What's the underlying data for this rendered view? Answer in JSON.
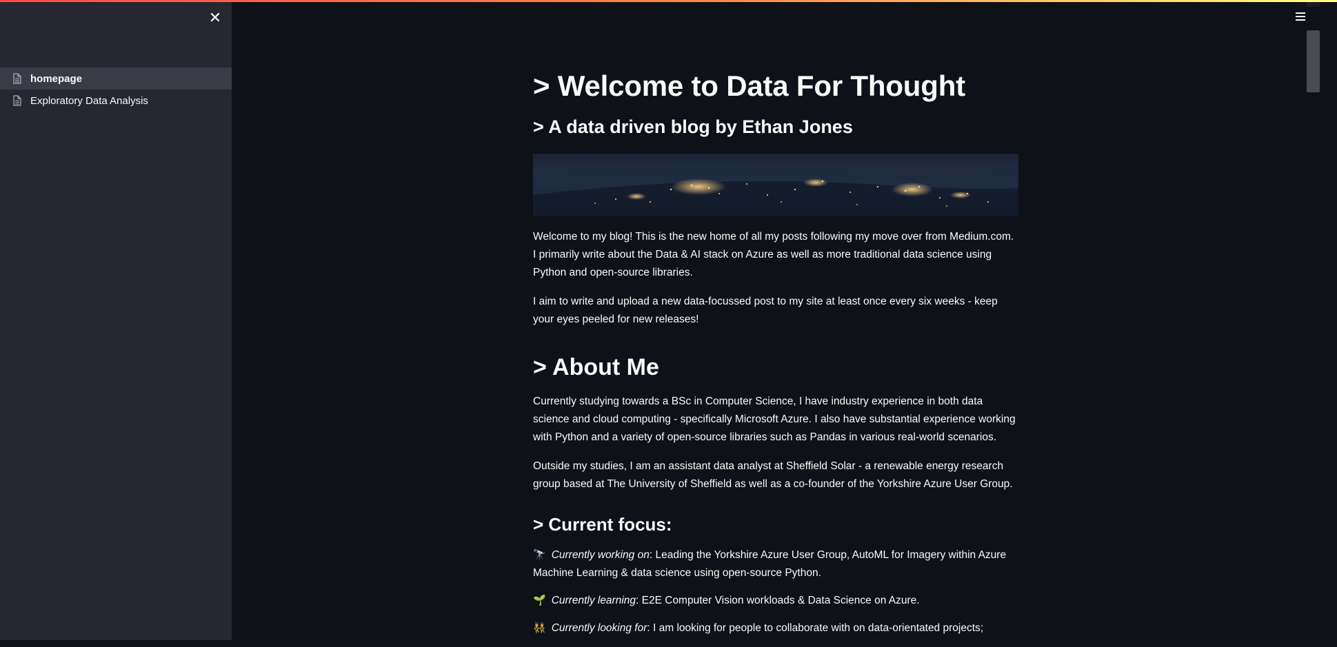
{
  "sidebar": {
    "close_icon": "✕",
    "items": [
      {
        "label": "homepage",
        "active": true
      },
      {
        "label": "Exploratory Data Analysis",
        "active": false
      }
    ]
  },
  "header": {
    "menu_icon": "hamburger-menu-icon"
  },
  "main": {
    "title": "> Welcome to Data For Thought",
    "subtitle": "> A data driven blog by Ethan Jones",
    "intro_paragraphs": [
      "Welcome to my blog! This is the new home of all my posts following my move over from Medium.com. I primarily write about the Data & AI stack on Azure as well as more traditional data science using Python and open-source libraries.",
      "I aim to write and upload a new data-focussed post to my site at least once every six weeks - keep your eyes peeled for new releases!"
    ],
    "about_heading": "> About Me",
    "about_paragraphs": [
      "Currently studying towards a BSc in Computer Science, I have industry experience in both data science and cloud computing - specifically Microsoft Azure. I also have substantial experience working with Python and a variety of open-source libraries such as Pandas in various real-world scenarios.",
      "Outside my studies, I am an assistant data analyst at Sheffield Solar - a renewable energy research group based at The University of Sheffield as well as a co-founder of the Yorkshire Azure User Group."
    ],
    "focus_heading": "> Current focus:",
    "focus_items": [
      {
        "emoji": "🔭",
        "label": "Currently working on",
        "text": ": Leading the Yorkshire Azure User Group, AutoML for Imagery within Azure Machine Learning & data science using open-source Python."
      },
      {
        "emoji": "🌱",
        "label": "Currently learning",
        "text": ": E2E Computer Vision workloads & Data Science on Azure."
      },
      {
        "emoji": "👯",
        "label": "Currently looking for",
        "text": ": I am looking for people to collaborate with on data-orientated projects;"
      }
    ]
  }
}
